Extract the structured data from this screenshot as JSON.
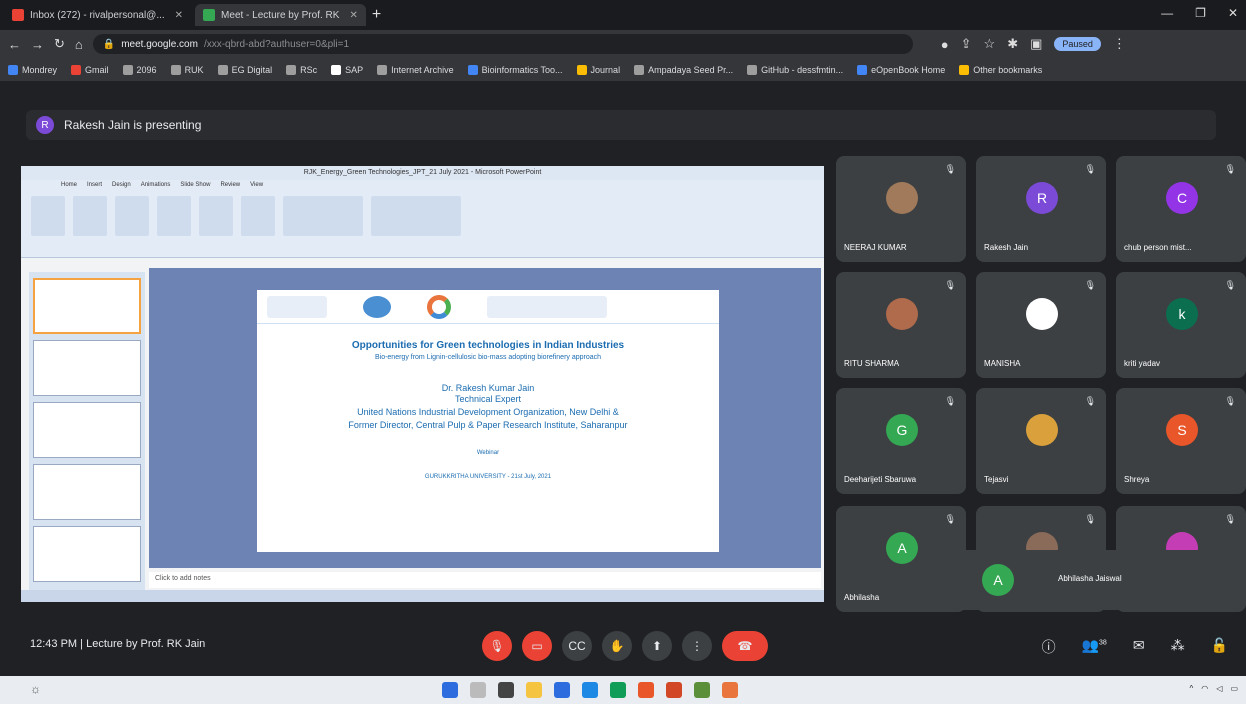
{
  "browser": {
    "tabs": [
      {
        "label": "Inbox (272) - rivalpersonal@...",
        "color": "#ea4335"
      },
      {
        "label": "Meet - Lecture by Prof. RK",
        "color": "#34a853",
        "active": true
      }
    ],
    "url_host": "meet.google.com",
    "url_rest": "/xxx-qbrd-abd?authuser=0&pli=1",
    "bookmarks": [
      {
        "label": "Mondrey",
        "color": "#4285f4"
      },
      {
        "label": "Gmail",
        "color": "#ea4335"
      },
      {
        "label": "2096",
        "color": "#9e9e9e"
      },
      {
        "label": "RUK",
        "color": "#9e9e9e"
      },
      {
        "label": "EG Digital",
        "color": "#9e9e9e"
      },
      {
        "label": "RSc",
        "color": "#9e9e9e"
      },
      {
        "label": "SAP",
        "color": "#ffffff"
      },
      {
        "label": "Internet Archive",
        "color": "#9e9e9e"
      },
      {
        "label": "Bioinformatics Too...",
        "color": "#4285f4"
      },
      {
        "label": "Journal",
        "color": "#fbbc04"
      },
      {
        "label": "Ampadaya Seed Pr...",
        "color": "#9e9e9e"
      },
      {
        "label": "GitHub - dessfmtin...",
        "color": "#9e9e9e"
      },
      {
        "label": "eOpenBook Home",
        "color": "#4285f4"
      },
      {
        "label": "Other bookmarks",
        "color": "#fbbc04"
      }
    ],
    "profile": "Paused"
  },
  "presenting": {
    "initial": "R",
    "text": "Rakesh Jain is presenting"
  },
  "slide": {
    "window_title": "RJK_Energy_Green Technologies_JPT_21 July 2021 - Microsoft PowerPoint",
    "title": "Opportunities for Green technologies in Indian Industries",
    "subtitle": "Bio-energy from Lignin-cellulosic bio-mass adopting biorefinery approach",
    "presenter": "Dr. Rakesh Kumar Jain",
    "role": "Technical Expert",
    "org_line1": "United Nations Industrial Development Organization, New Delhi &",
    "org_line2": "Former Director, Central Pulp & Paper Research Institute, Saharanpur",
    "webinar": "Webinar",
    "webinar_detail": "GURUKKRITHA UNIVERSITY - 21st July, 2021",
    "notes_placeholder": "Click to add notes"
  },
  "participants": [
    {
      "name": "NEERAJ KUMAR",
      "initial": "",
      "color": "#a07a5a"
    },
    {
      "name": "Rakesh Jain",
      "initial": "R",
      "color": "#7b4ad6"
    },
    {
      "name": "chub person mist...",
      "initial": "C",
      "color": "#9334e6"
    },
    {
      "name": "RITU SHARMA",
      "initial": "",
      "color": "#b06a4c"
    },
    {
      "name": "MANISHA",
      "initial": "",
      "color": "#ffffff"
    },
    {
      "name": "kriti yadav",
      "initial": "k",
      "color": "#0b6e4f"
    },
    {
      "name": "Deeharijeti Sbaruwa",
      "initial": "G",
      "color": "#34a853"
    },
    {
      "name": "Tejasvi",
      "initial": "",
      "color": "#d9a03b"
    },
    {
      "name": "Shreya",
      "initial": "S",
      "color": "#e8562a"
    },
    {
      "name": "Abhilasha",
      "initial": "A",
      "color": "#34a853"
    },
    {
      "name": "",
      "initial": "",
      "color": "#8a6a58"
    },
    {
      "name": "",
      "initial": "",
      "color": "#c43db5"
    }
  ],
  "floating_tile": {
    "initial": "A",
    "name": "Abhilasha Jaiswal"
  },
  "meet": {
    "time": "12:43 PM",
    "separator": "|",
    "meeting_title": "Lecture by Prof. RK Jain"
  },
  "controls": {
    "mic": "mic-off-icon",
    "camera": "camera-off-icon",
    "captions": "CC",
    "hand": "raise-hand-icon",
    "present": "present-icon",
    "more": "⋮",
    "end": "end-call-icon"
  },
  "right_controls": {
    "info": "ⓘ",
    "people_count": "38",
    "chat": "chat-icon",
    "activities": "activities-icon",
    "lock": "lock-icon"
  }
}
